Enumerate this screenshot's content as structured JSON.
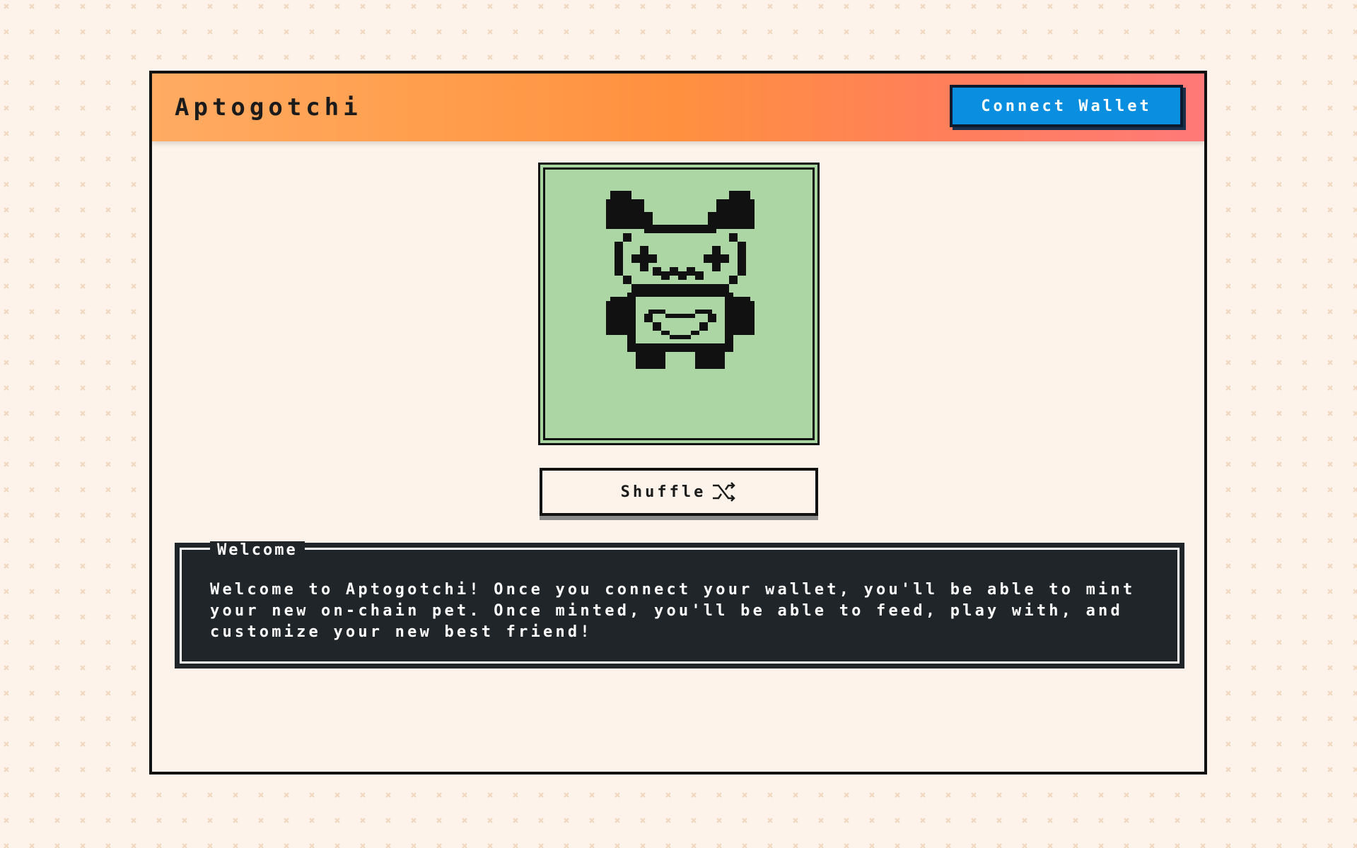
{
  "colors": {
    "page_background": "#fdf3ea",
    "pattern_mark": "#f3d9c0",
    "header_gradient": [
      "#ffab63",
      "#ff9040",
      "#ff7a78"
    ],
    "connect_button": "#0a8ee0",
    "pet_screen": "#acd6a3",
    "welcome_box": "#202529"
  },
  "header": {
    "title": "Aptogotchi",
    "connect_wallet_label": "Connect Wallet"
  },
  "pet": {
    "sprite": "bunny-pet-sprite"
  },
  "shuffle": {
    "label": "Shuffle",
    "icon": "shuffle-icon"
  },
  "welcome": {
    "legend": "Welcome",
    "message": "Welcome to Aptogotchi! Once you connect your wallet, you'll be able to mint your new on-chain pet. Once minted, you'll be able to feed, play with, and customize your new best friend!"
  }
}
